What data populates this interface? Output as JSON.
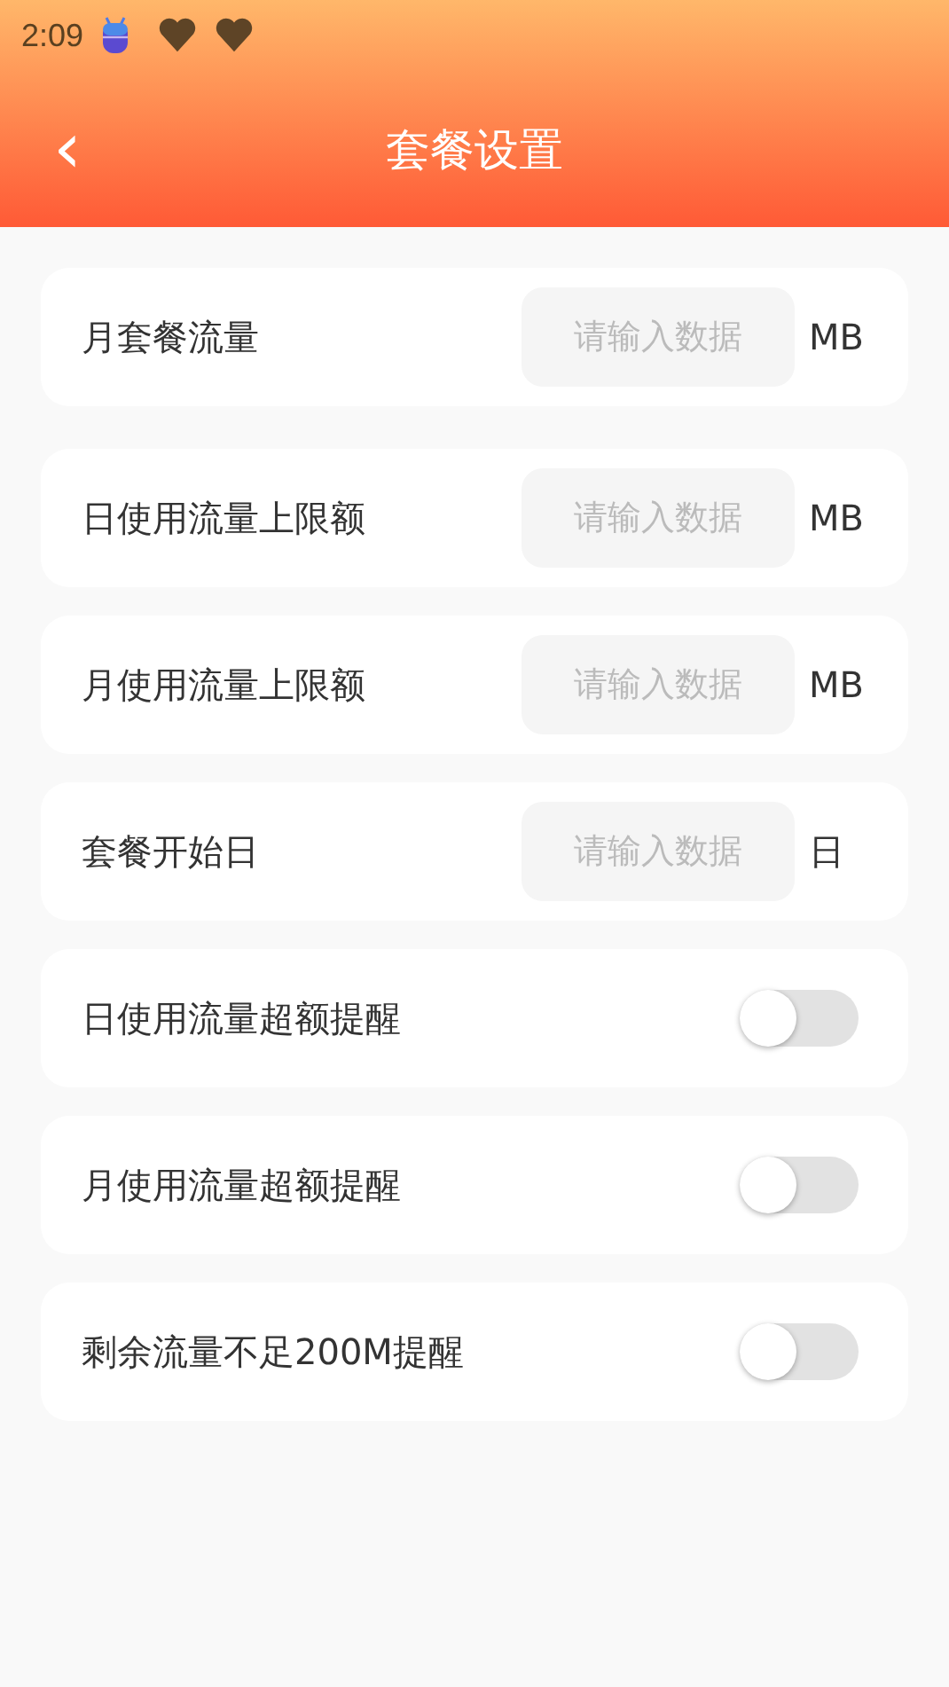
{
  "status_bar": {
    "time": "2:09"
  },
  "header": {
    "title": "套餐设置",
    "back": "‹"
  },
  "settings": [
    {
      "kind": "input",
      "label": "月套餐流量",
      "placeholder": "请输入数据",
      "unit": "MB"
    },
    {
      "kind": "input",
      "label": "日使用流量上限额",
      "placeholder": "请输入数据",
      "unit": "MB"
    },
    {
      "kind": "input",
      "label": "月使用流量上限额",
      "placeholder": "请输入数据",
      "unit": "MB"
    },
    {
      "kind": "input",
      "label": "套餐开始日",
      "placeholder": "请输入数据",
      "unit": "日"
    },
    {
      "kind": "toggle",
      "label": "日使用流量超额提醒",
      "on": false
    },
    {
      "kind": "toggle",
      "label": "月使用流量超额提醒",
      "on": false
    },
    {
      "kind": "toggle",
      "label": "剩余流量不足200M提醒",
      "on": false
    }
  ]
}
